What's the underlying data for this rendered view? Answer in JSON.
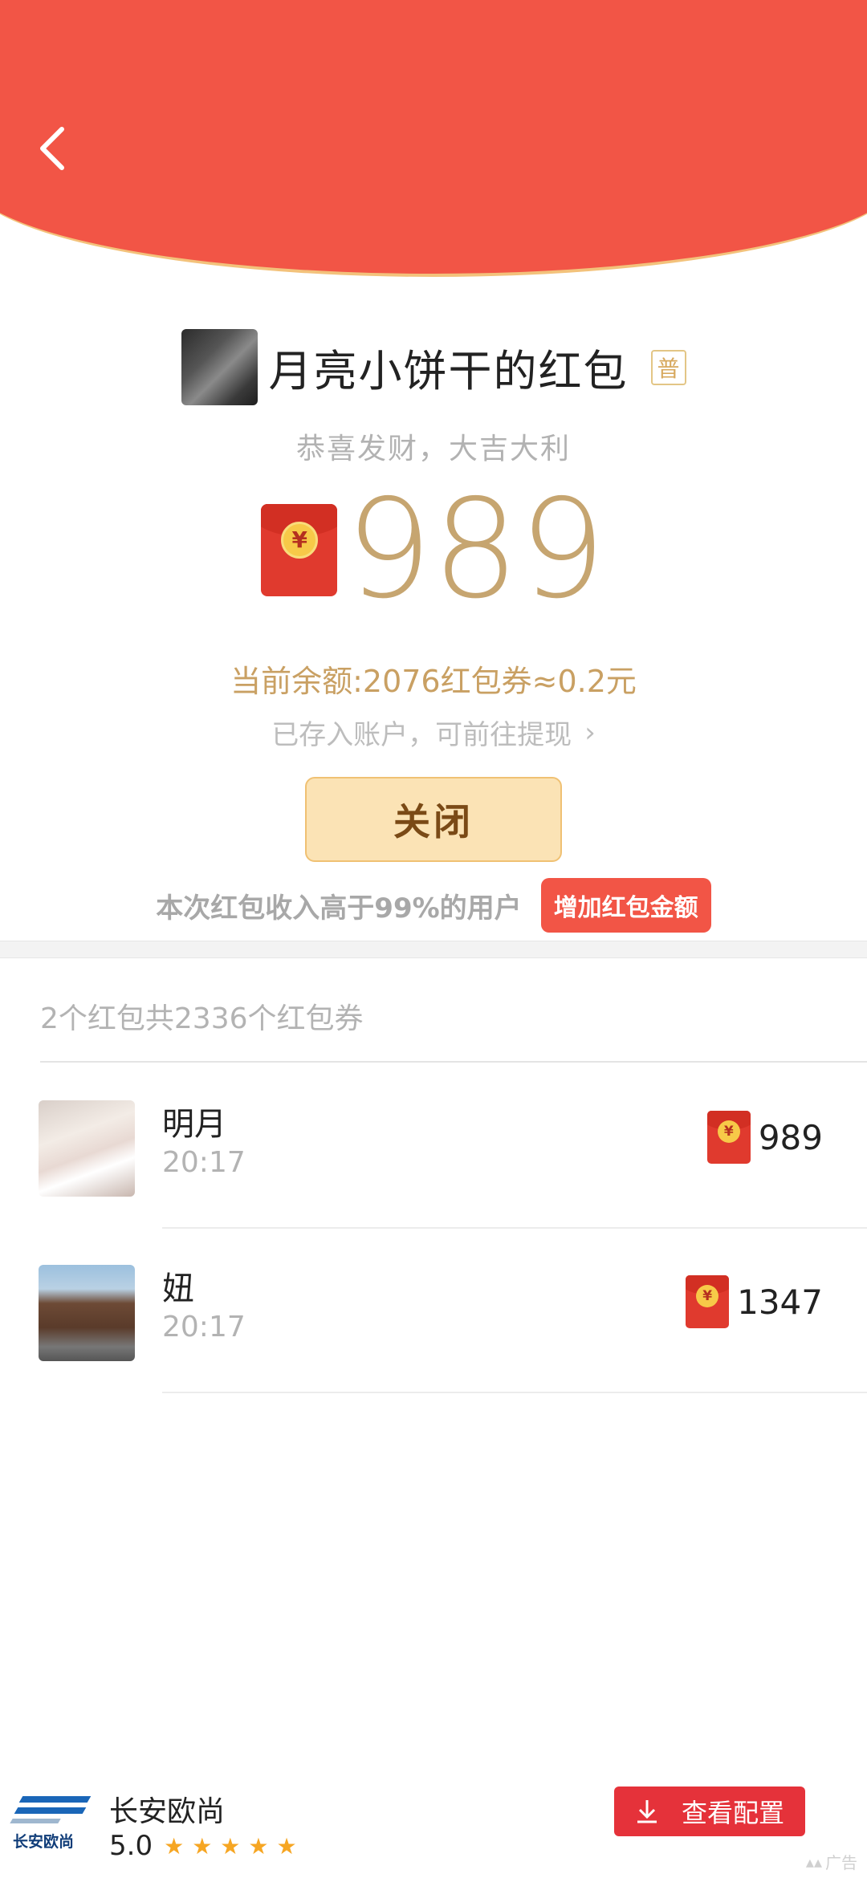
{
  "header": {
    "back_icon": "chevron-left-icon",
    "accent_color": "#f25546"
  },
  "sender": {
    "title": "月亮小饼干的红包",
    "badge": "普"
  },
  "greeting": "恭喜发财，大吉大利",
  "amount": {
    "value": "989",
    "currency_symbol": "¥"
  },
  "balance_text": "当前余额:2076红包券≈0.2元",
  "deposit_text": "已存入账户，可前往提现",
  "close_label": "关闭",
  "rank_text": "本次红包收入高于99%的用户",
  "increase_label": "增加红包金额",
  "summary_text": "2个红包共2336个红包券",
  "list": [
    {
      "name": "明月",
      "time": "20:17",
      "amount": "989"
    },
    {
      "name": "妞",
      "time": "20:17",
      "amount": "1347"
    }
  ],
  "ad": {
    "logo_text": "长安欧尚",
    "name": "长安欧尚",
    "score": "5.0",
    "stars": 5,
    "button_label": "查看配置",
    "ad_label": "广告"
  }
}
